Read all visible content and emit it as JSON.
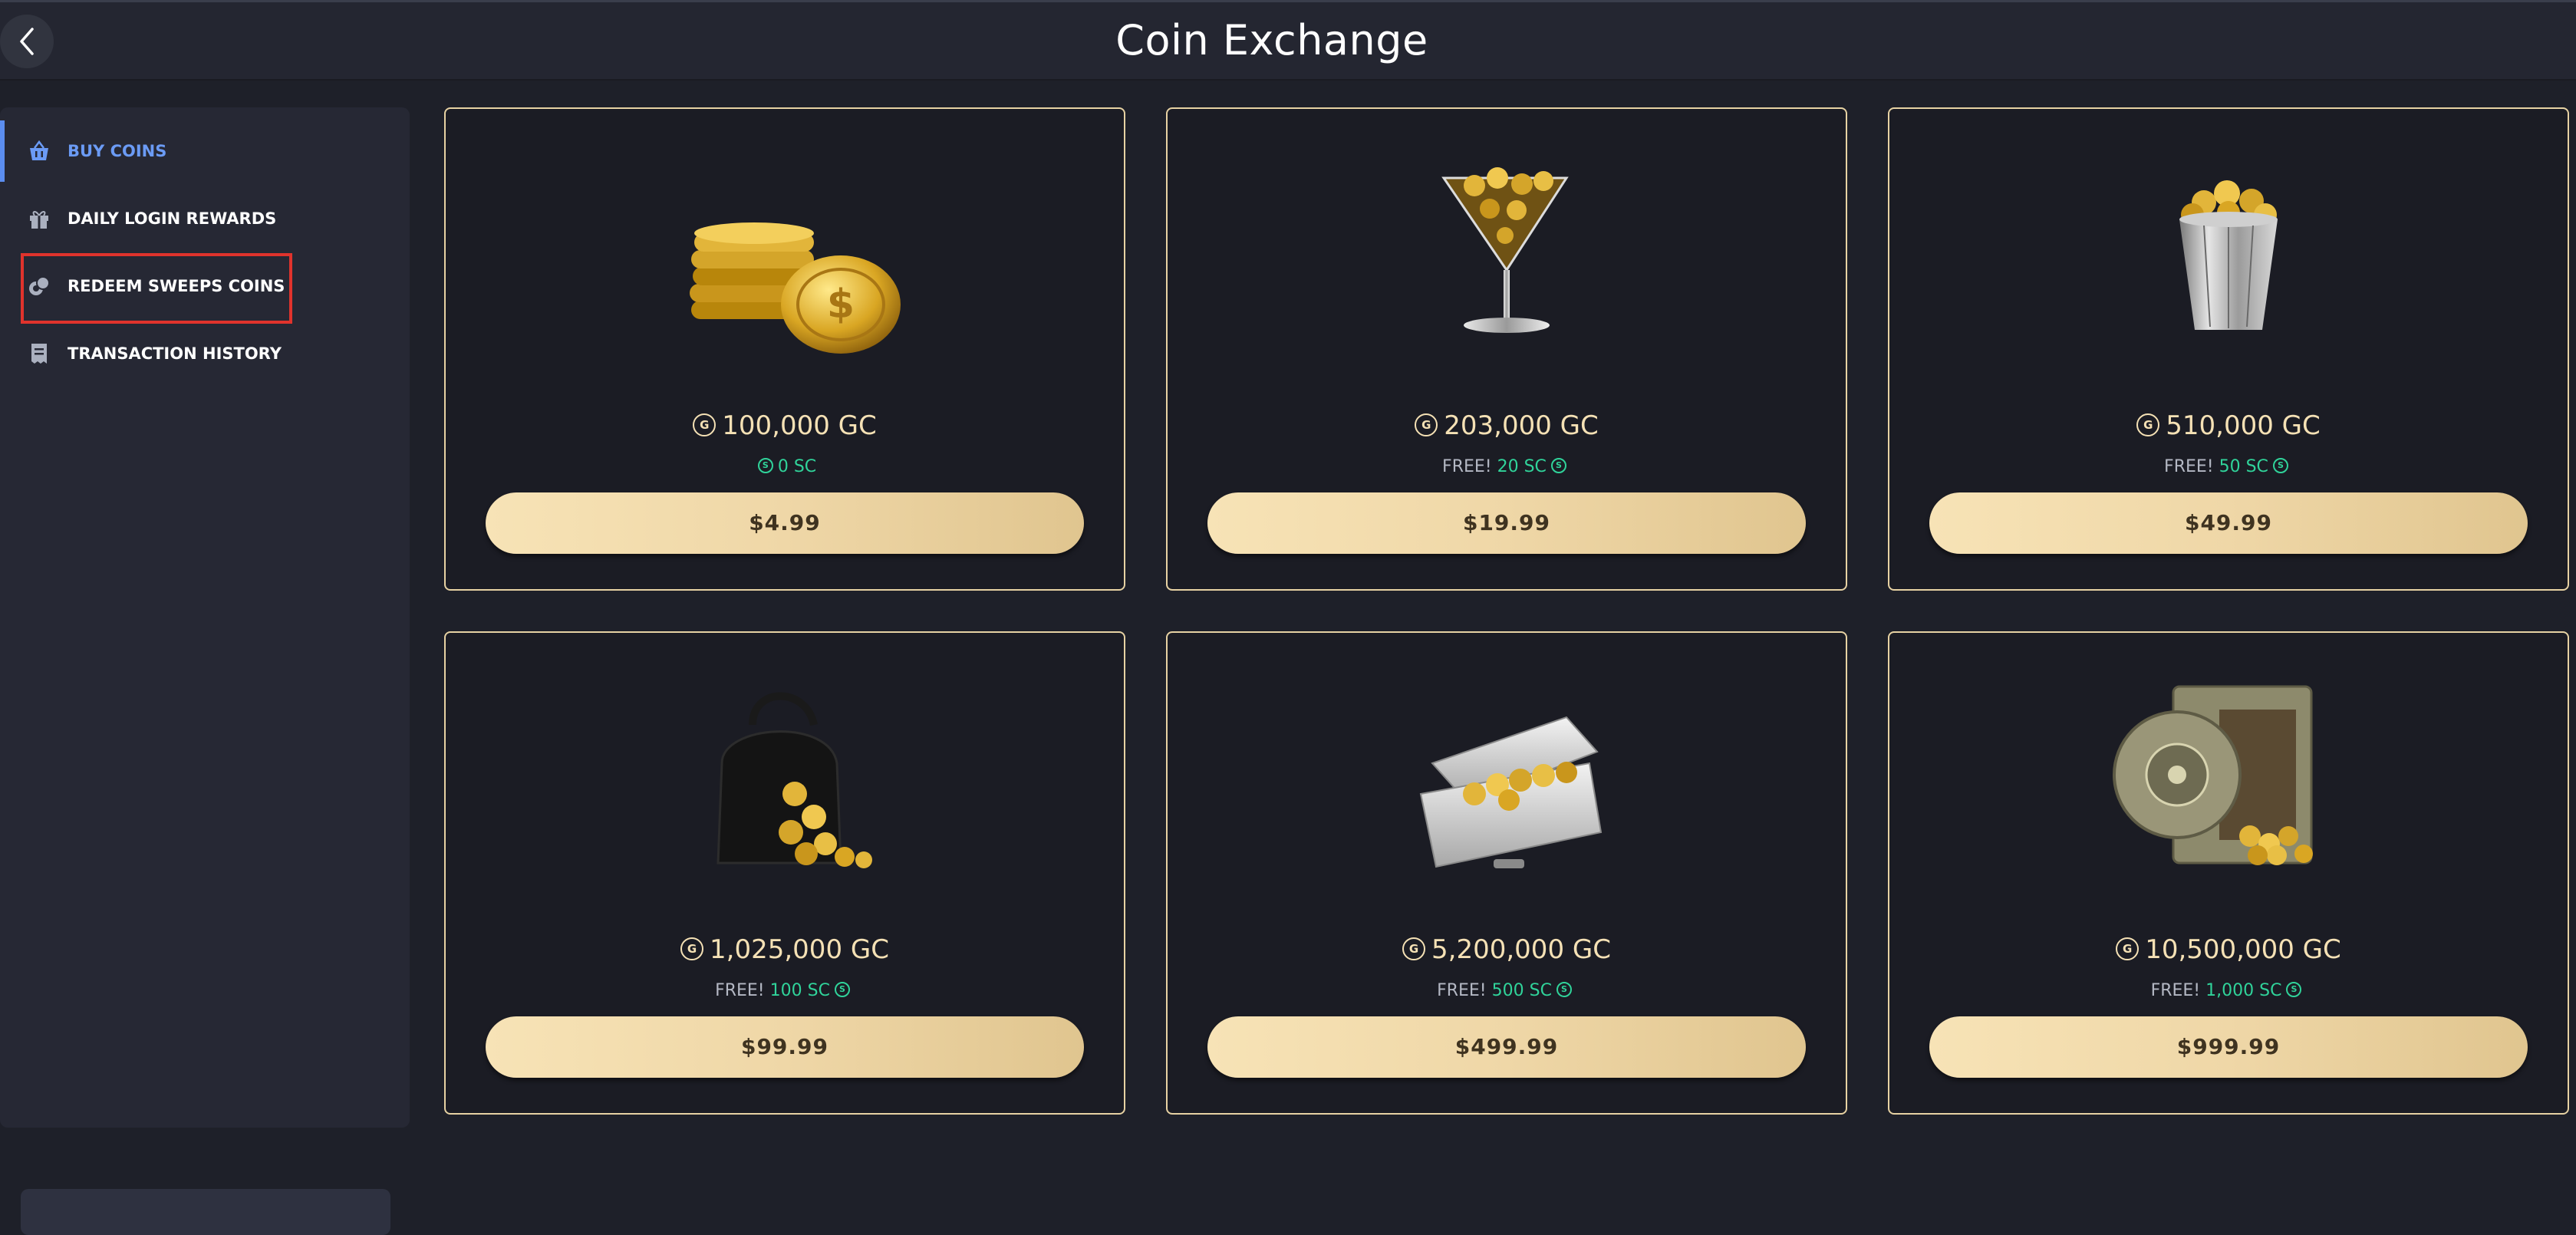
{
  "header": {
    "title": "Coin Exchange"
  },
  "sidebar": {
    "items": [
      {
        "label": "BUY COINS",
        "icon": "basket-icon",
        "active": true
      },
      {
        "label": "DAILY LOGIN REWARDS",
        "icon": "gift-icon",
        "active": false
      },
      {
        "label": "REDEEM SWEEPS COINS",
        "icon": "coins-icon",
        "active": false
      },
      {
        "label": "TRANSACTION HISTORY",
        "icon": "receipt-icon",
        "active": false
      }
    ]
  },
  "packages": [
    {
      "art": "coin-stack-icon",
      "amount": "100,000 GC",
      "free_prefix": "",
      "bonus": "0 SC",
      "price": "$4.99"
    },
    {
      "art": "martini-coins-icon",
      "amount": "203,000 GC",
      "free_prefix": "FREE!",
      "bonus": "20 SC",
      "price": "$19.99"
    },
    {
      "art": "bucket-coins-icon",
      "amount": "510,000 GC",
      "free_prefix": "FREE!",
      "bonus": "50 SC",
      "price": "$49.99"
    },
    {
      "art": "handbag-coins-icon",
      "amount": "1,025,000 GC",
      "free_prefix": "FREE!",
      "bonus": "100 SC",
      "price": "$99.99"
    },
    {
      "art": "briefcase-coins-icon",
      "amount": "5,200,000 GC",
      "free_prefix": "FREE!",
      "bonus": "500 SC",
      "price": "$499.99"
    },
    {
      "art": "vault-coins-icon",
      "amount": "10,500,000 GC",
      "free_prefix": "FREE!",
      "bonus": "1,000 SC",
      "price": "$999.99"
    }
  ],
  "colors": {
    "accent": "#6b9bf5",
    "gold": "#f5e1b5",
    "sweeps_green": "#30d39a",
    "highlight": "#e0332c"
  }
}
